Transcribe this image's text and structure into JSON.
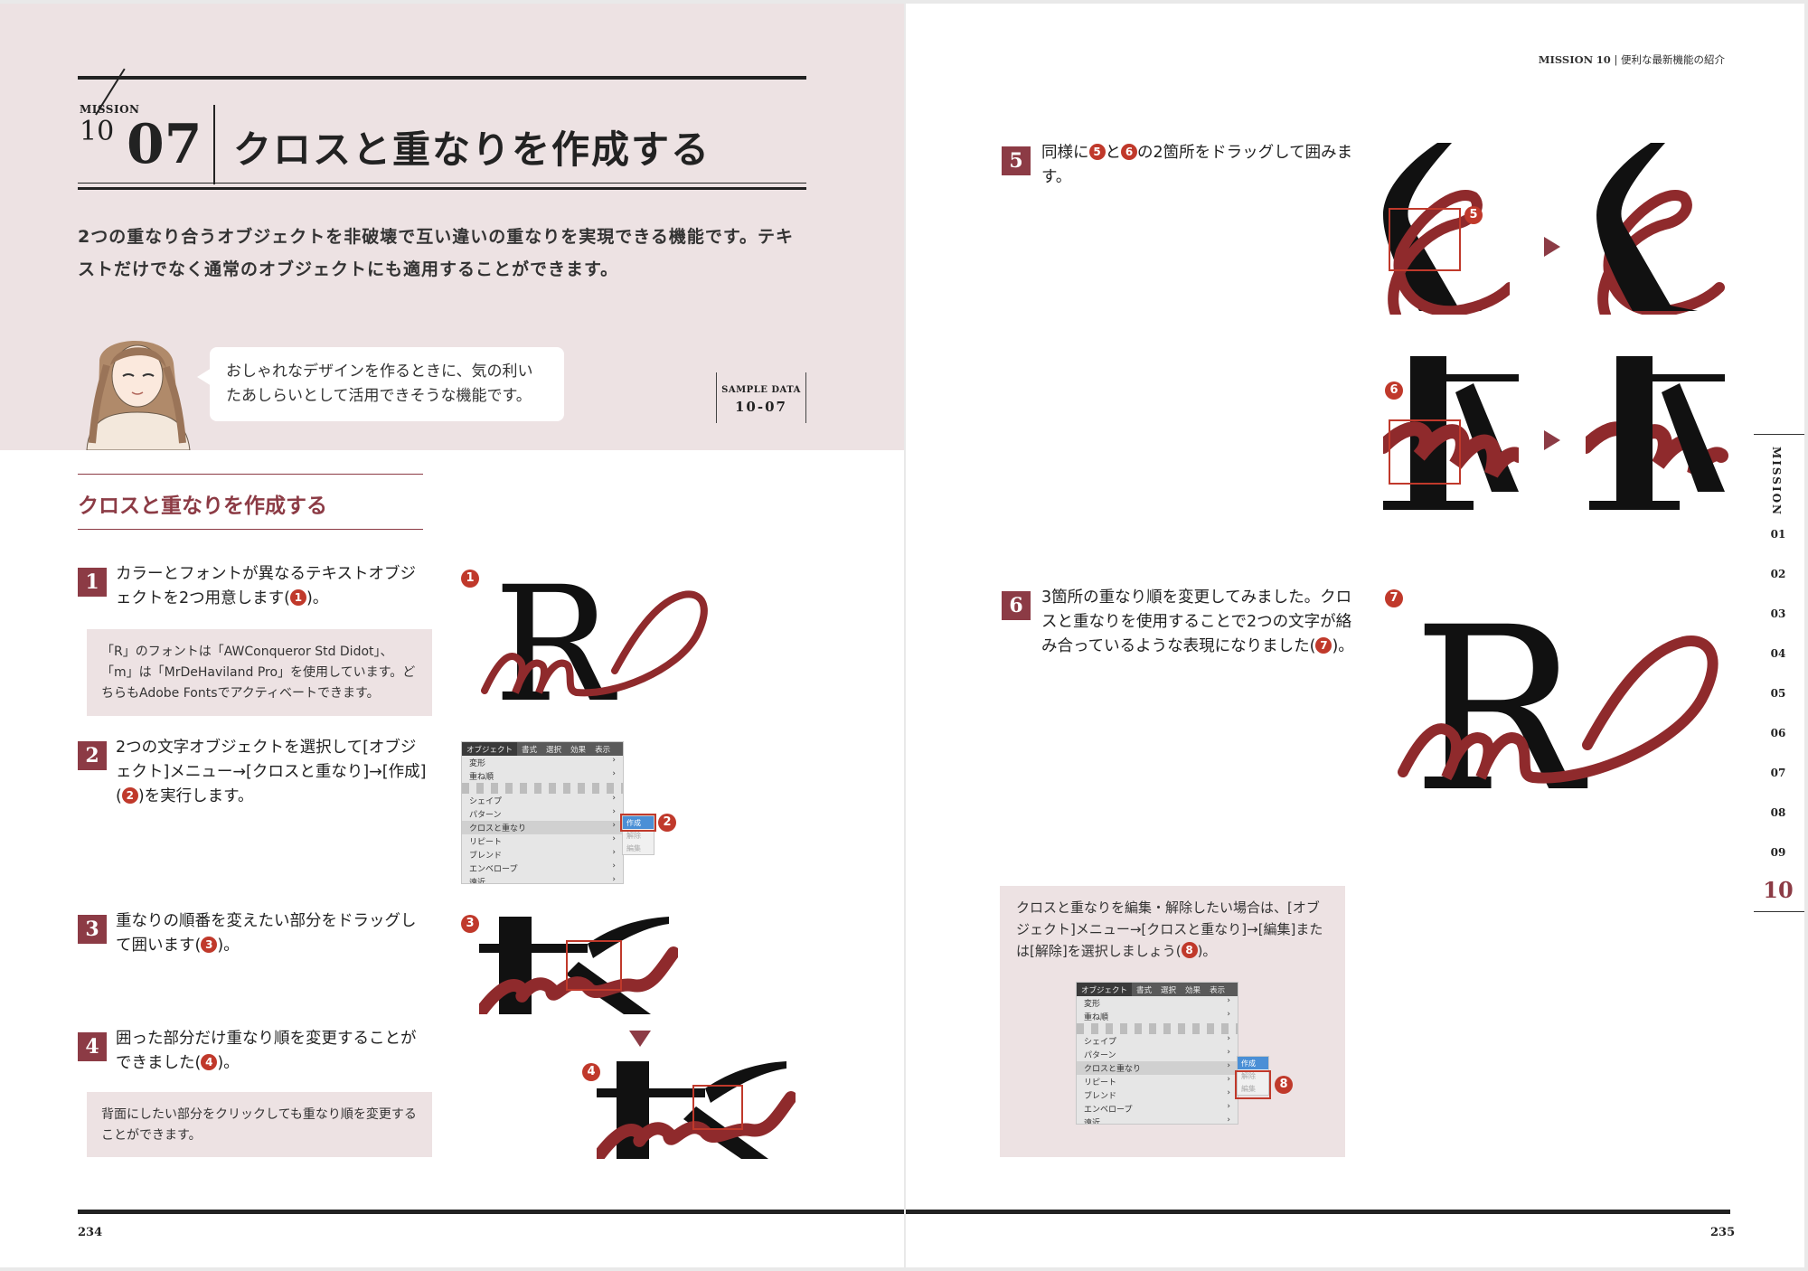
{
  "left_page": {
    "mission_label": "MISSION",
    "mission_number": "10",
    "lesson_number": "07",
    "title": "クロスと重なりを作成する",
    "intro": "2つの重なり合うオブジェクトを非破壊で互い違いの重なりを実現できる機能です。テキストだけでなく通常のオブジェクトにも適用することができます。",
    "speech": "おしゃれなデザインを作るときに、気の利いたあしらいとして活用できそうな機能です。",
    "sample_label": "SAMPLE DATA",
    "sample_number": "10-07",
    "section_heading": "クロスと重なりを作成する",
    "folio": "234"
  },
  "steps": [
    {
      "number": "1",
      "text_a": "カラーとフォントが異なるテキストオブジェクトを2つ用意します(",
      "marker": "1",
      "text_b": ")。"
    },
    {
      "number": "2",
      "text_a": "2つの文字オブジェクトを選択して[オブジェクト]メニュー→[クロスと重なり]→[作成](",
      "marker": "2",
      "text_b": ")を実行します。"
    },
    {
      "number": "3",
      "text_a": "重なりの順番を変えたい部分をドラッグして囲います(",
      "marker": "3",
      "text_b": ")。"
    },
    {
      "number": "4",
      "text_a": "囲った部分だけ重なり順を変更することができました(",
      "marker": "4",
      "text_b": ")。"
    },
    {
      "number": "5",
      "text_a": "同様に",
      "marker_a": "5",
      "text_mid": "と",
      "marker_b": "6",
      "text_b": "の2箇所をドラッグして囲みます。"
    },
    {
      "number": "6",
      "text_a": "3箇所の重なり順を変更してみました。クロスと重なりを使用することで2つの文字が絡み合っているような表現になりました(",
      "marker": "7",
      "text_b": ")。"
    }
  ],
  "notes": {
    "fonts": "「R」のフォントは「AWConqueror Std Didot」、「m」は「MrDeHaviland Pro」を使用しています。どちらもAdobe Fontsでアクティベートできます。",
    "step4": "背面にしたい部分をクリックしても重なり順を変更することができます。",
    "edit_a": "クロスと重なりを編集・解除したい場合は、[オブジェクト]メニュー→[クロスと重なり]→[編集]または[解除]を選択しましょう(",
    "edit_marker": "8",
    "edit_b": ")。"
  },
  "menu": {
    "bar": [
      "オブジェクト",
      "書式",
      "選択",
      "効果",
      "表示"
    ],
    "top_items": [
      "変形",
      "重ね順"
    ],
    "items": [
      "シェイプ",
      "パターン",
      "クロスと重なり",
      "リピート",
      "ブレンド",
      "エンベロープ",
      "遠近"
    ],
    "highlighted": "クロスと重なり",
    "submenu": [
      "作成",
      "解除",
      "編集"
    ]
  },
  "markers": [
    "1",
    "2",
    "3",
    "4",
    "5",
    "6",
    "7",
    "8"
  ],
  "right_page": {
    "running_head_mission": "MISSION",
    "running_head_number": "10",
    "running_head_title": "便利な最新機能の紹介",
    "side_label": "MISSION",
    "side_tabs": [
      "01",
      "02",
      "03",
      "04",
      "05",
      "06",
      "07",
      "08",
      "09",
      "10"
    ],
    "side_active": "10",
    "folio": "235"
  },
  "colors": {
    "accent": "#8c3b45",
    "pink_bg": "#ede2e3",
    "marker": "#c0392b",
    "script": "#8f2a2c",
    "ink": "#111111"
  }
}
